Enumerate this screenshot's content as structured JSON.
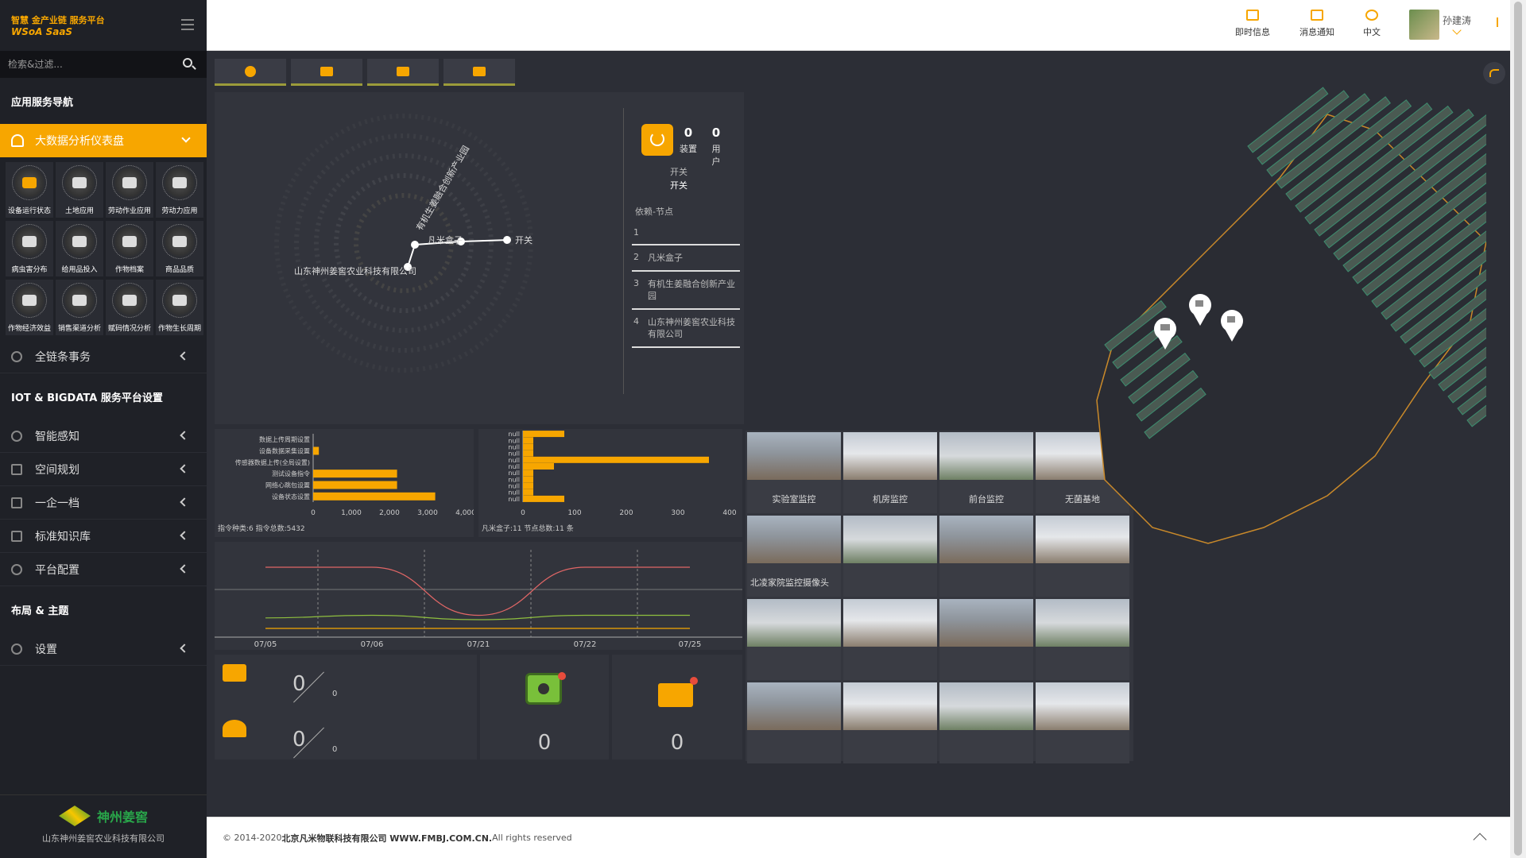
{
  "logo": {
    "line1": "智慧 金产业链 服务平台",
    "line2": "WSoA SaaS"
  },
  "search": {
    "placeholder": "检索&过滤..."
  },
  "sidebar": {
    "section1": "应用服务导航",
    "active_item": "大数据分析仪表盘",
    "grid": [
      "设备运行状态",
      "土地应用",
      "劳动作业应用",
      "劳动力应用",
      "病虫害分布",
      "给用品投入",
      "作物档案",
      "商品品质",
      "作物经济效益",
      "销售渠道分析",
      "赋码情况分析",
      "作物生长周期"
    ],
    "item_all_chain": "全链条事务",
    "section2": "IOT & BIGDATA 服务平台设置",
    "items": [
      "智能感知",
      "空间规划",
      "一企一档",
      "标准知识库",
      "平台配置"
    ],
    "section3": "布局 & 主题",
    "settings": "设置",
    "footer_logo": "神州姜窖",
    "footer_company": "山东神州姜窖农业科技有限公司"
  },
  "topbar": {
    "instant": "即时信息",
    "notify": "消息通知",
    "lang": "中文",
    "user": "孙建涛"
  },
  "graph": {
    "nodes": [
      "山东神州姜窖农业科技有限公司",
      "有机生姜融合创新产业园",
      "凡米盒子",
      "开关"
    ],
    "ring_label": "开关"
  },
  "switch_card": {
    "devices_count": "0",
    "devices_label": "装置",
    "users_count": "0",
    "users_label": "用户",
    "sub1": "开关",
    "sub2": "开关",
    "deps_title": "依赖-节点",
    "deps": [
      {
        "n": "1",
        "t": ""
      },
      {
        "n": "2",
        "t": "凡米盒子"
      },
      {
        "n": "3",
        "t": "有机生姜融合创新产业园"
      },
      {
        "n": "4",
        "t": "山东神州姜窖农业科技有限公司"
      }
    ]
  },
  "bar1": {
    "footer": "指令种类:6 指令总数:5432",
    "xticks": [
      "0",
      "1,000",
      "2,000",
      "3,000",
      "4,000"
    ]
  },
  "bar2": {
    "footer": "凡米盒子:11 节点总数:11 条",
    "xticks": [
      "0",
      "100",
      "200",
      "300",
      "400"
    ]
  },
  "chart_data": [
    {
      "type": "bar",
      "orientation": "horizontal",
      "categories": [
        "设备状态设置",
        "网络心跳包设置",
        "测试设备指令",
        "传感器数据上传(全局设置)",
        "设备数据采集设置",
        "数据上传周期设置"
      ],
      "values": [
        3200,
        2200,
        2200,
        0,
        150,
        0
      ],
      "xlim": [
        0,
        4000
      ]
    },
    {
      "type": "bar",
      "orientation": "horizontal",
      "categories": [
        "null",
        "null",
        "null",
        "null",
        "null",
        "null",
        "null",
        "null",
        "null",
        "null",
        "null"
      ],
      "values": [
        80,
        20,
        20,
        20,
        360,
        60,
        20,
        20,
        20,
        20,
        80
      ],
      "xlim": [
        0,
        400
      ]
    },
    {
      "type": "line",
      "x": [
        "07/05",
        "07/06",
        "07/21",
        "07/22",
        "07/25"
      ],
      "series": [
        {
          "color": "#e06666",
          "values": [
            80,
            80,
            25,
            80,
            80
          ]
        },
        {
          "color": "#8fbf3f",
          "values": [
            22,
            25,
            20,
            25,
            25
          ]
        },
        {
          "color": "#f7a600",
          "values": [
            10,
            10,
            10,
            10,
            10
          ]
        }
      ]
    }
  ],
  "stats": {
    "row1_num": "0",
    "row1_sub": "0",
    "row2_num": "0",
    "row2_sub": "0",
    "chip_num": "0",
    "mon_num": "0"
  },
  "cams": [
    "实验室监控",
    "机房监控",
    "前台监控",
    "无菌基地",
    "北凌家院监控摄像头",
    "",
    "",
    "",
    "",
    "",
    "",
    "",
    "",
    "",
    "",
    ""
  ],
  "footer": {
    "prefix": "© 2014-2020 ",
    "company": "北京凡米物联科技有限公司 WWW.FMBJ.COM.CN.",
    "suffix": " All rights reserved"
  }
}
